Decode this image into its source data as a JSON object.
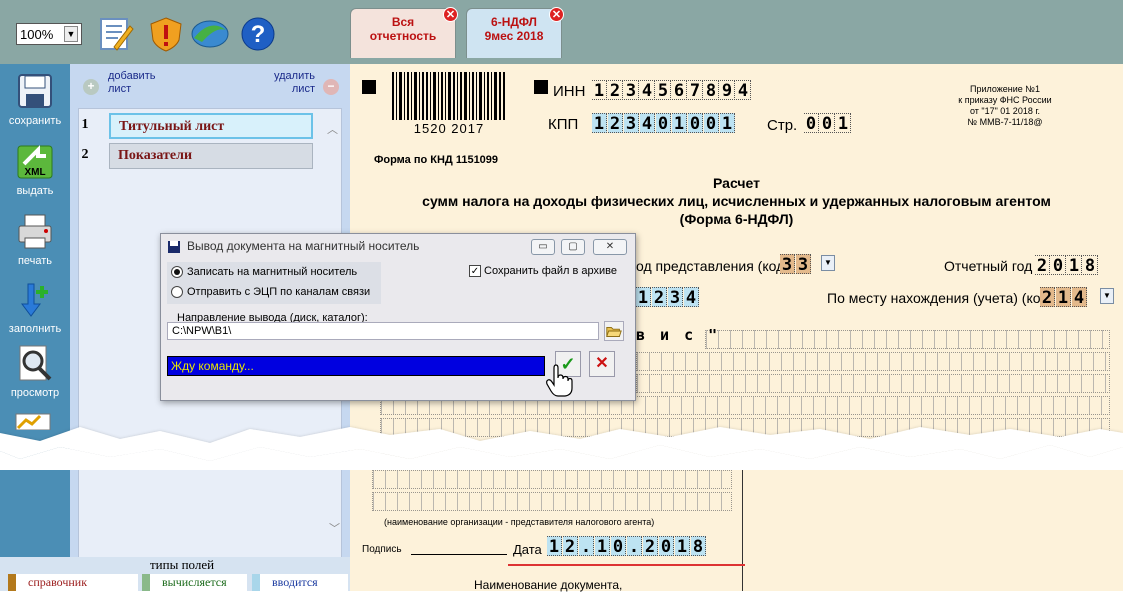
{
  "toolbar": {
    "zoom": "100%",
    "tabs": [
      {
        "line1": "Вся",
        "line2": "отчетность"
      },
      {
        "line1": "6-НДФЛ",
        "line2": "9мес 2018"
      }
    ]
  },
  "rail": {
    "save": "сохранить",
    "xml_icon": "XML",
    "export": "выдать",
    "print": "печать",
    "fill": "заполнить",
    "preview": "просмотр"
  },
  "sheets": {
    "add": [
      "добавить",
      "лист"
    ],
    "remove": [
      "удалить",
      "лист"
    ],
    "items": [
      {
        "num": "1",
        "label": "Титульный лист"
      },
      {
        "num": "2",
        "label": "Показатели"
      }
    ],
    "legend_title": "типы полей",
    "legend": [
      "справочник",
      "вычисляется",
      "вводится"
    ]
  },
  "form": {
    "barcode_digits": "1520  2017",
    "inn_label": "ИНН",
    "inn": [
      "1",
      "2",
      "3",
      "4",
      "5",
      "6",
      "7",
      "8",
      "9",
      "4"
    ],
    "kpp_label": "КПП",
    "kpp": [
      "1",
      "2",
      "3",
      "4",
      "0",
      "1",
      "0",
      "0",
      "1"
    ],
    "page_label": "Стр.",
    "page": [
      "0",
      "0",
      "1"
    ],
    "knd": "Форма по КНД 1151099",
    "appendix": [
      "Приложение №1",
      "к приказу ФНС России",
      "от \"17\"  01  2018 г.",
      "№ ММВ-7-11/18@"
    ],
    "title1": "Расчет",
    "title2": "сумм налога на доходы физических лиц, исчисленных и удержанных налоговым агентом",
    "title3": "(Форма 6-НДФЛ)",
    "period_label": "од представления (код)",
    "period": [
      "3",
      "3"
    ],
    "year_label": "Отчетный год",
    "year": [
      "2",
      "0",
      "1",
      "8"
    ],
    "tax_code": [
      "1",
      "2",
      "3",
      "4"
    ],
    "location_label": "По месту нахождения (учета) (код)",
    "location": [
      "2",
      "1",
      "4"
    ],
    "org_fragment": "в и с \"",
    "representative_note": "(наименование организации - представителя налогового агента)",
    "sign_label": "Подпись",
    "date_label": "Дата",
    "date": [
      "1",
      "2",
      ".",
      "1",
      "0",
      ".",
      "2",
      "0",
      "1",
      "8"
    ],
    "doc_name_label": "Наименование документа,"
  },
  "dialog": {
    "title": "Вывод документа на магнитный носитель",
    "option_write": "Записать на магнитный носитель",
    "option_send": "Отправить с ЭЦП по каналам связи",
    "archive_label": "Сохранить файл в архиве",
    "path_label": "Направление вывода (диск, каталог):",
    "path_value": "C:\\NPW\\B1\\",
    "status": "Жду команду...",
    "colors": {
      "status_bg": "#0000e0",
      "status_text": "#e8e800",
      "ok": "#1a9a1a",
      "cancel": "#cc1111"
    }
  }
}
